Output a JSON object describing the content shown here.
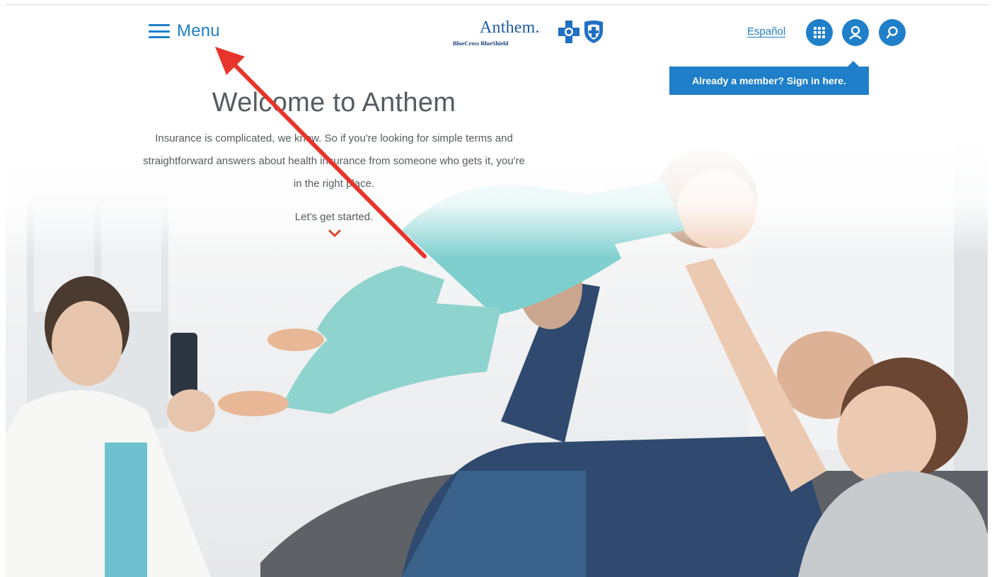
{
  "header": {
    "menu_label": "Menu",
    "logo": {
      "wordmark": "Anthem.",
      "subline": "BlueCross BlueShield"
    },
    "language_link": "Español",
    "icons": {
      "apps": "apps-grid-icon",
      "account": "user-account-icon",
      "search": "search-icon"
    },
    "signin_tooltip": "Already a member? Sign in here."
  },
  "hero": {
    "title": "Welcome to Anthem",
    "body": "Insurance is complicated, we know. So if you're looking for simple terms and straightforward answers about health insurance from someone who gets it, you're in the right place.",
    "cta": "Let's get started."
  },
  "colors": {
    "brand_blue": "#1f7fc9",
    "text_gray": "#555b60",
    "chevron_red": "#e0452b",
    "annotation_red": "#e8352b"
  }
}
